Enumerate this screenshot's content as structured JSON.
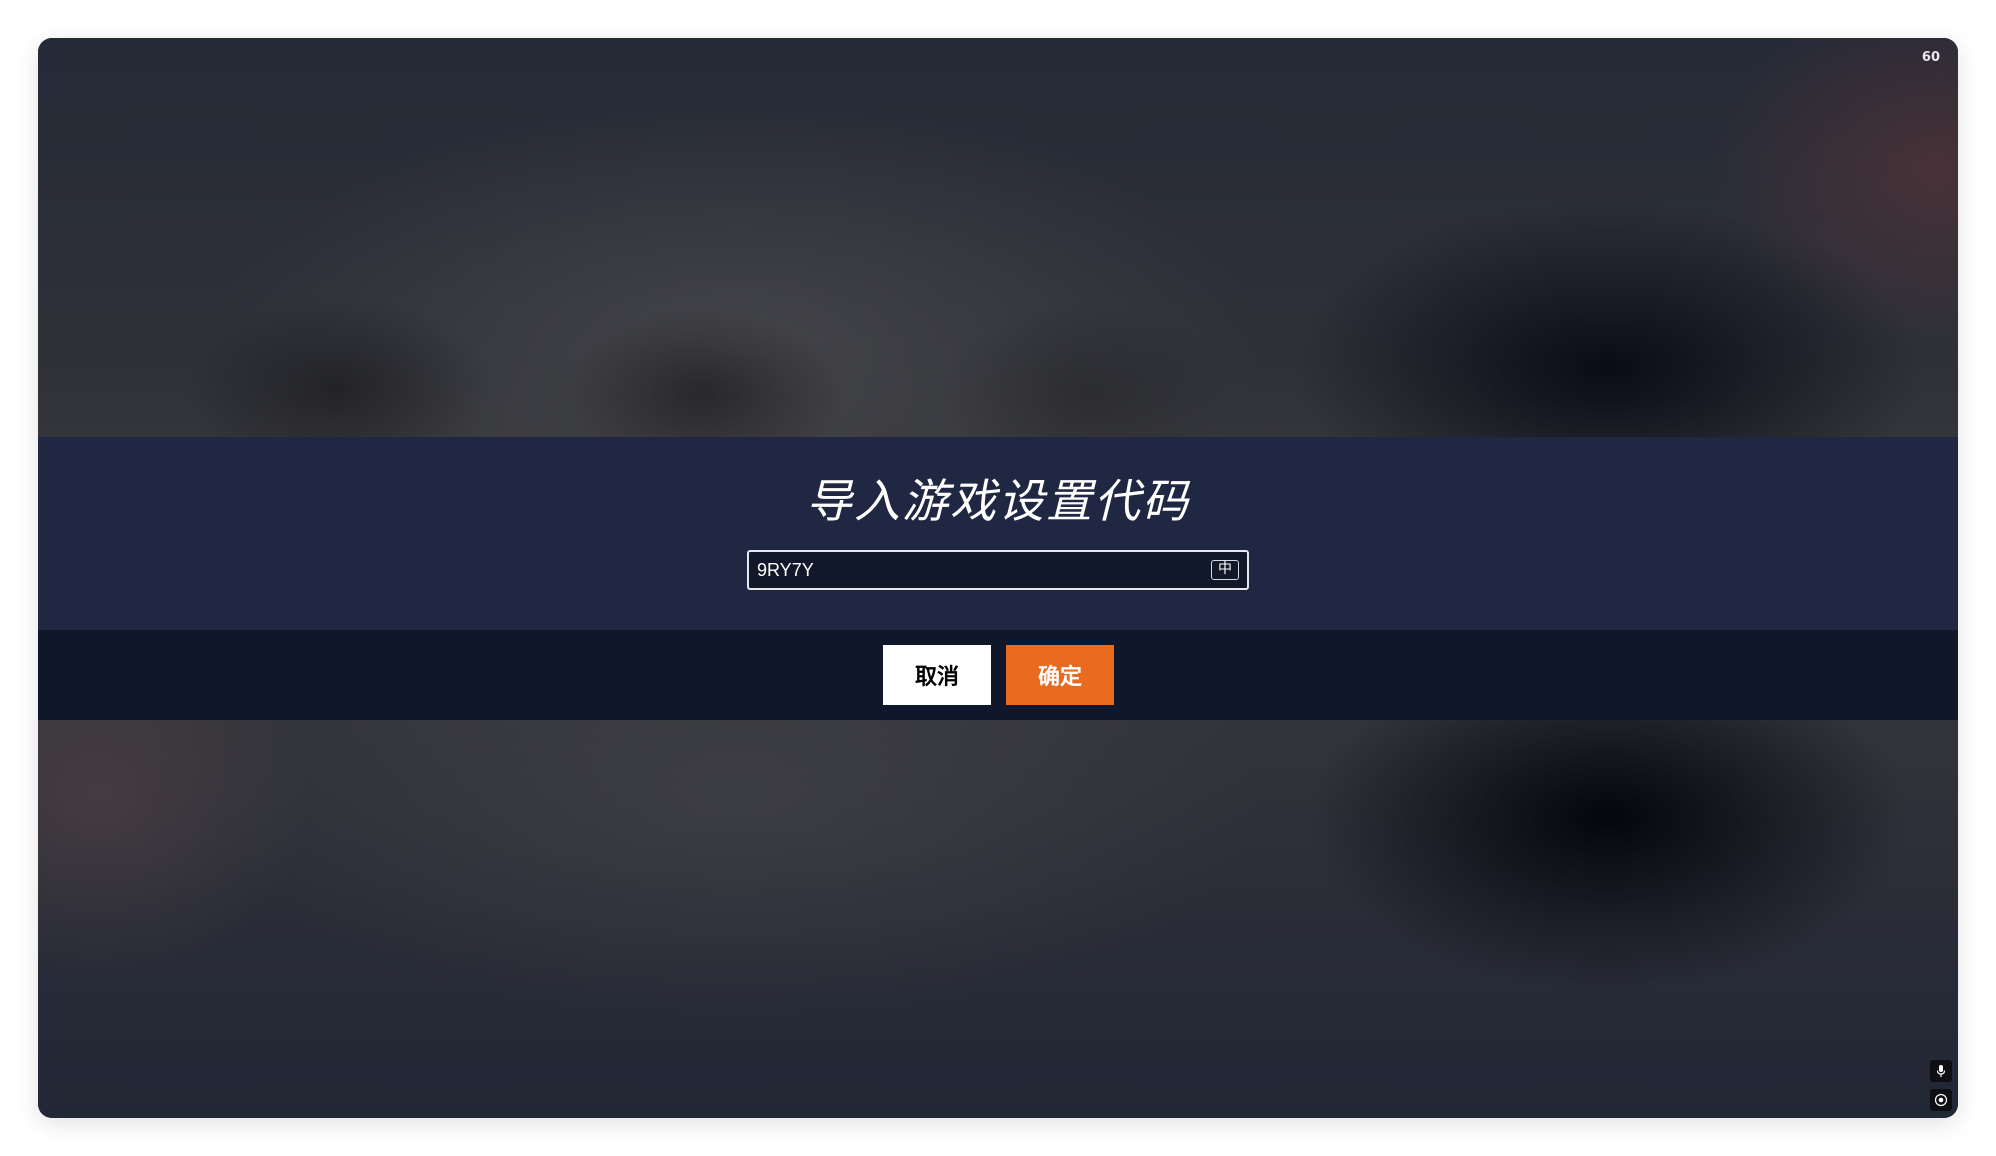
{
  "overlay": {
    "fps_counter": "60"
  },
  "dialog": {
    "title": "导入游戏设置代码",
    "code_input_value": "9RY7Y",
    "ime_indicator": "中",
    "cancel_label": "取消",
    "confirm_label": "确定"
  },
  "colors": {
    "dialog_band": "#202743",
    "action_band": "#11172b",
    "confirm_button": "#ea6a1f",
    "cancel_button": "#ffffff"
  },
  "side_controls": {
    "icons": [
      "microphone-icon",
      "record-icon"
    ]
  }
}
